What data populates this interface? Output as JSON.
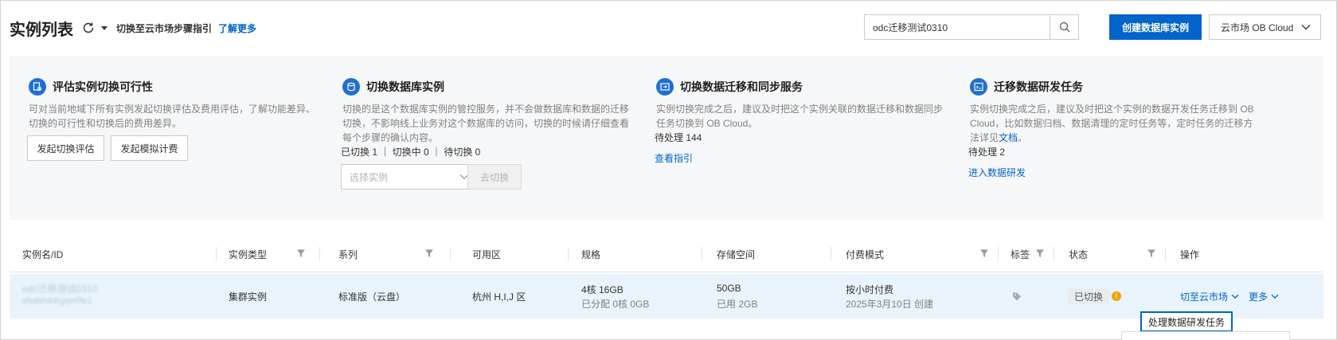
{
  "header": {
    "title": "实例列表",
    "guide": "切换至云市场步骤指引",
    "learn_more": "了解更多"
  },
  "search": {
    "value": "odc迁移测试0310",
    "placeholder": ""
  },
  "create_button": "创建数据库实例",
  "region": "云市场 OB Cloud",
  "cards": [
    {
      "title": "评估实例切换可行性",
      "desc": "可对当前地域下所有实例发起切换评估及费用评估，了解功能差异、切换的可行性和切换后的费用差异。",
      "buttons": [
        "发起切换评估",
        "发起模拟计费"
      ]
    },
    {
      "title": "切换数据库实例",
      "desc": "切换的是这个数据库实例的管控服务，并不会做数据库和数据的迁移切换，不影响线上业务对这个数据库的访问，切换的时候请仔细查看每个步骤的确认内容。",
      "stats": "已切换 1 ｜ 切换中 0 ｜ 待切换 0",
      "select_placeholder": "选择实例",
      "switch_label": "去切换"
    },
    {
      "title": "切换数据迁移和同步服务",
      "desc": "实例切换完成之后，建议及时把这个实例关联的数据迁移和数据同步任务切换到 OB Cloud。",
      "pending": "待处理 144",
      "link": "查看指引"
    },
    {
      "title": "迁移数据研发任务",
      "desc_before": "实例切换完成之后，建议及时把这个实例的数据开发任务迁移到 OB Cloud，比如数据归档、数据清理的定时任务等，定时任务的迁移方法详见",
      "desc_link": "文档",
      "desc_after": "。",
      "pending": "待处理 2",
      "link": "进入数据研发"
    }
  ],
  "table": {
    "columns": [
      "实例名/ID",
      "实例类型",
      "系列",
      "可用区",
      "规格",
      "存储空间",
      "付费模式",
      "标签",
      "状态",
      "操作"
    ],
    "row": {
      "name": "odc迁移测试0310",
      "id": "obabh4drgrpr0fe1",
      "type": "集群实例",
      "series": "标准版（云盘）",
      "zone": "杭州 H,I,J 区",
      "spec": "4核 16GB",
      "spec_sub": "已分配 0核 0GB",
      "storage": "50GB",
      "storage_sub": "已用 2GB",
      "billing": "按小时付费",
      "billing_sub": "2025年3月10日 创建",
      "status": "已切换",
      "warn_symbol": "!",
      "action_switch": "切至云市场",
      "action_more": "更多"
    },
    "popup": "处理数据研发任务"
  },
  "colors": {
    "primary": "#0064c8",
    "row_highlight": "#e8f3fc",
    "panel_bg": "#f6f7f9",
    "warning": "#f0a400"
  }
}
